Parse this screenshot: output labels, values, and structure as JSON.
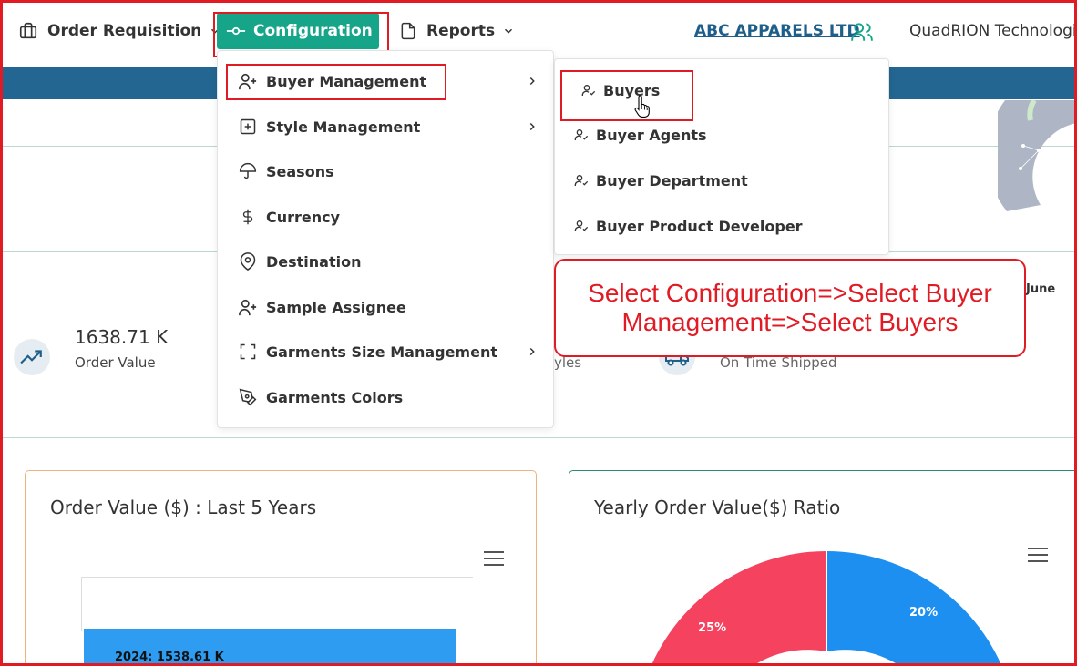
{
  "topnav": {
    "order_requisition": "Order Requisition",
    "configuration": "Configuration",
    "reports": "Reports",
    "company": "ABC APPARELS LTD",
    "organization": "QuadRION Technologies"
  },
  "configuration_menu": {
    "items": [
      {
        "label": "Buyer Management",
        "icon": "user-plus-icon",
        "has_submenu": true
      },
      {
        "label": "Style Management",
        "icon": "plus-square-icon",
        "has_submenu": true
      },
      {
        "label": "Seasons",
        "icon": "umbrella-icon",
        "has_submenu": false
      },
      {
        "label": "Currency",
        "icon": "dollar-icon",
        "has_submenu": false
      },
      {
        "label": "Destination",
        "icon": "map-pin-icon",
        "has_submenu": false
      },
      {
        "label": "Sample Assignee",
        "icon": "user-plus-icon",
        "has_submenu": false
      },
      {
        "label": "Garments Size Management",
        "icon": "frame-icon",
        "has_submenu": true
      },
      {
        "label": "Garments Colors",
        "icon": "pen-tool-icon",
        "has_submenu": false
      }
    ]
  },
  "buyer_management_submenu": {
    "items": [
      {
        "label": "Buyers"
      },
      {
        "label": "Buyer Agents"
      },
      {
        "label": "Buyer Department"
      },
      {
        "label": "Buyer Product Developer"
      }
    ]
  },
  "callout": {
    "text": "Select Configuration=>Select Buyer Management=>Select Buyers"
  },
  "dashboard": {
    "kpi_order_value": {
      "value": "1638.71 K",
      "label": "Order Value"
    },
    "kpi_styles_fragment": "yles",
    "kpi_on_time": "On Time Shipped",
    "kpi_june": "June",
    "card_left": {
      "title": "Order Value ($) : Last 5 Years",
      "bar_label": "2024: 1538.61 K"
    },
    "card_right": {
      "title": "Yearly Order Value($) Ratio",
      "slice_labels": [
        "25%",
        "20%"
      ]
    }
  },
  "colors": {
    "accent": "#17a589",
    "header_bar": "#236691",
    "annotation_red": "#e01b24",
    "bar_blue": "#2e9cf0",
    "donut_red": "#f4425f",
    "donut_blue": "#1d8ff0"
  }
}
